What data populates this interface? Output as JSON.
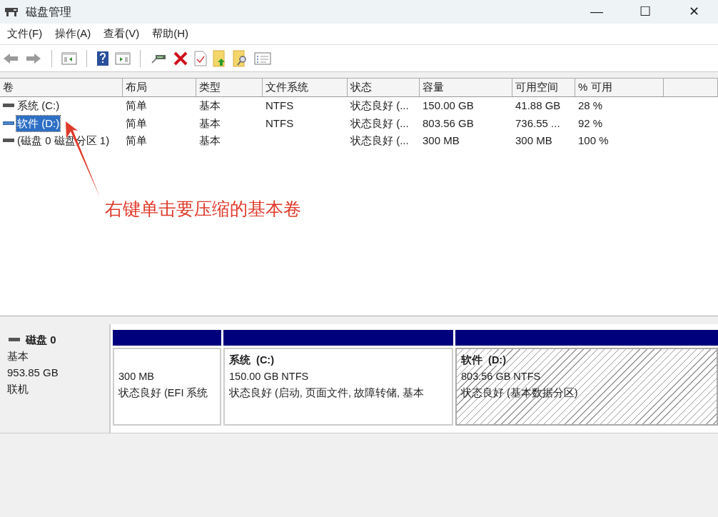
{
  "window": {
    "title": "磁盘管理",
    "controls": [
      "—",
      "☐",
      "✕"
    ]
  },
  "menu": [
    "文件(F)",
    "操作(A)",
    "查看(V)",
    "帮助(H)"
  ],
  "toolbar": [
    {
      "kind": "back"
    },
    {
      "kind": "forward"
    },
    {
      "kind": "sep"
    },
    {
      "kind": "tree"
    },
    {
      "kind": "sep"
    },
    {
      "kind": "help"
    },
    {
      "kind": "pane"
    },
    {
      "kind": "sep"
    },
    {
      "kind": "drive"
    },
    {
      "kind": "delete"
    },
    {
      "kind": "check"
    },
    {
      "kind": "folderup"
    },
    {
      "kind": "foldersearch"
    },
    {
      "kind": "props"
    }
  ],
  "table": {
    "columns": [
      "卷",
      "布局",
      "类型",
      "文件系统",
      "状态",
      "容量",
      "可用空间",
      "% 可用"
    ],
    "rows": [
      {
        "selected": false,
        "cells": [
          "系统 (C:)",
          "简单",
          "基本",
          "NTFS",
          "状态良好 (...",
          "150.00 GB",
          "41.88 GB",
          "28 %"
        ]
      },
      {
        "selected": true,
        "cells": [
          "软件 (D:)",
          "简单",
          "基本",
          "NTFS",
          "状态良好 (...",
          "803.56 GB",
          "736.55 ...",
          "92 %"
        ]
      },
      {
        "selected": false,
        "cells": [
          "(磁盘 0 磁盘分区 1)",
          "简单",
          "基本",
          "",
          "状态良好 (...",
          "300 MB",
          "300 MB",
          "100 %"
        ]
      }
    ]
  },
  "annotation": {
    "text": "右键单击要压缩的基本卷"
  },
  "disk": {
    "name": "磁盘 0",
    "type": "基本",
    "size": "953.85 GB",
    "status": "联机",
    "partitions": [
      {
        "selected": false,
        "size": "300 MB",
        "status": "状态良好 (EFI 系统"
      },
      {
        "selected": false,
        "title": "系统  (C:)",
        "size": "150.00 GB NTFS",
        "status": "状态良好 (启动, 页面文件, 故障转储, 基本"
      },
      {
        "selected": true,
        "title": "软件  (D:)",
        "size": "803.56 GB NTFS",
        "status": "状态良好 (基本数据分区)"
      }
    ]
  }
}
